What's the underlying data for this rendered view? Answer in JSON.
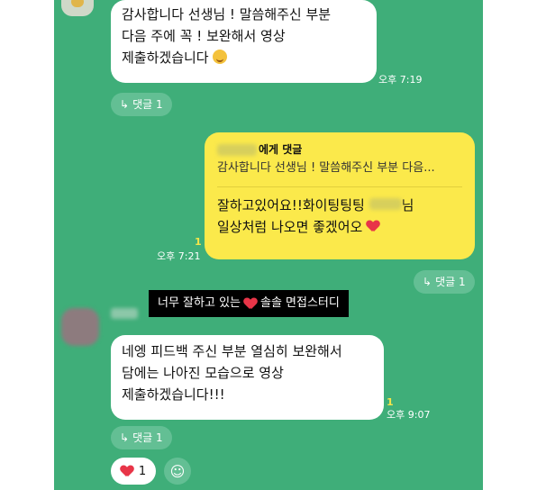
{
  "messages": {
    "m1": {
      "lines": [
        "감사합니다 선생님 ! 말씀해주신 부분",
        "다음 주에 꼭 ! 보완해서 영상",
        "제출하겠습니다"
      ],
      "time": "오후 7:19",
      "reply_label": "댓글 1"
    },
    "m2": {
      "to_suffix": "에게 댓글",
      "quote": "감사합니다 선생님 ! 말씀해주신 부분 다음...",
      "line1_a": "잘하고있어요!!화이팅팅팅",
      "line1_b": "님",
      "line2": "일상처럼 나오면 좋겠어오",
      "unread": "1",
      "time": "오후 7:21",
      "reply_label": "댓글 1"
    },
    "caption": {
      "part1": "너무 잘하고 있는",
      "part2": "솔솔 면접스터디"
    },
    "m3": {
      "lines": [
        "네엥 피드백 주신 부분 열심히 보완해서",
        "담에는 나아진 모습으로 영상",
        "제출하겠습니다!!!"
      ],
      "unread": "1",
      "time": "오후 9:07",
      "reply_label": "댓글 1"
    },
    "reaction": {
      "count": "1"
    }
  },
  "icons": {
    "reply": "reply-arrow-icon",
    "heart": "heart-icon",
    "add_reaction": "add-emoji-icon",
    "smile": "smiling-face-icon"
  },
  "colors": {
    "background": "#3fae79",
    "my_bubble": "#fbe94b",
    "their_bubble": "#ffffff",
    "unread": "#f4e54a"
  }
}
